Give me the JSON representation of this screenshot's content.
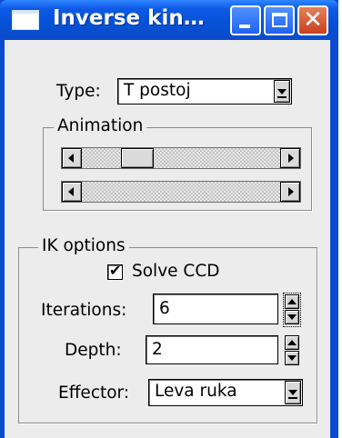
{
  "window": {
    "title": "Inverse kin…",
    "controls": {
      "minimize": "minimize",
      "maximize": "maximize",
      "close": "✕"
    }
  },
  "type_row": {
    "label": "Type:",
    "value": "T postoj"
  },
  "animation": {
    "title": "Animation",
    "slider_top_position": 0.12,
    "slider_bottom_position": 0.0
  },
  "ik_options": {
    "title": "IK options",
    "solve_ccd": {
      "label": "Solve CCD",
      "checked": true,
      "mark": "✔"
    },
    "iterations": {
      "label": "Iterations:",
      "value": "6"
    },
    "depth": {
      "label": "Depth:",
      "value": "2"
    },
    "effector": {
      "label": "Effector:",
      "value": "Leva ruka"
    }
  },
  "colors": {
    "titlebar": "#0552d8",
    "frame": "#0a4bd0",
    "client": "#ececec",
    "close_button": "#c8401e"
  }
}
